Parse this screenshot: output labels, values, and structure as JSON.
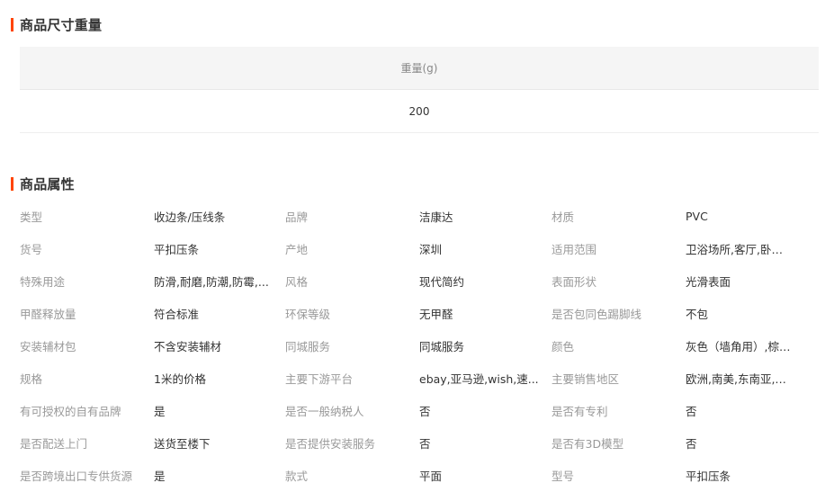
{
  "size_section": {
    "title": "商品尺寸重量",
    "columns": [
      "重量(g)"
    ],
    "rows": [
      [
        "200"
      ]
    ]
  },
  "attr_section": {
    "title": "商品属性",
    "rows": [
      [
        {
          "label": "类型",
          "value": "收边条/压线条"
        },
        {
          "label": "品牌",
          "value": "洁康达"
        },
        {
          "label": "材质",
          "value": "PVC"
        }
      ],
      [
        {
          "label": "货号",
          "value": "平扣压条"
        },
        {
          "label": "产地",
          "value": "深圳"
        },
        {
          "label": "适用范围",
          "value": "卫浴场所,客厅,卧室,..."
        }
      ],
      [
        {
          "label": "特殊用途",
          "value": "防滑,耐磨,防潮,防霉,..."
        },
        {
          "label": "风格",
          "value": "现代简约"
        },
        {
          "label": "表面形状",
          "value": "光滑表面"
        }
      ],
      [
        {
          "label": "甲醛释放量",
          "value": "符合标准"
        },
        {
          "label": "环保等级",
          "value": "无甲醛"
        },
        {
          "label": "是否包同色踢脚线",
          "value": "不包"
        }
      ],
      [
        {
          "label": "安装辅材包",
          "value": "不含安装辅材"
        },
        {
          "label": "同城服务",
          "value": "同城服务"
        },
        {
          "label": "颜色",
          "value": "灰色（墙角用）,棕色..."
        }
      ],
      [
        {
          "label": "规格",
          "value": "1米的价格"
        },
        {
          "label": "主要下游平台",
          "value": "ebay,亚马逊,wish,速..."
        },
        {
          "label": "主要销售地区",
          "value": "欧洲,南美,东南亚,北..."
        }
      ],
      [
        {
          "label": "有可授权的自有品牌",
          "value": "是"
        },
        {
          "label": "是否一般纳税人",
          "value": "否"
        },
        {
          "label": "是否有专利",
          "value": "否"
        }
      ],
      [
        {
          "label": "是否配送上门",
          "value": "送货至楼下"
        },
        {
          "label": "是否提供安装服务",
          "value": "否"
        },
        {
          "label": "是否有3D模型",
          "value": "否"
        }
      ],
      [
        {
          "label": "是否跨境出口专供货源",
          "value": "是"
        },
        {
          "label": "款式",
          "value": "平面"
        },
        {
          "label": "型号",
          "value": "平扣压条"
        }
      ]
    ]
  },
  "colors": {
    "accent": "#ff4400",
    "label": "#999999",
    "value": "#333333",
    "header_bg": "#f5f5f5"
  }
}
